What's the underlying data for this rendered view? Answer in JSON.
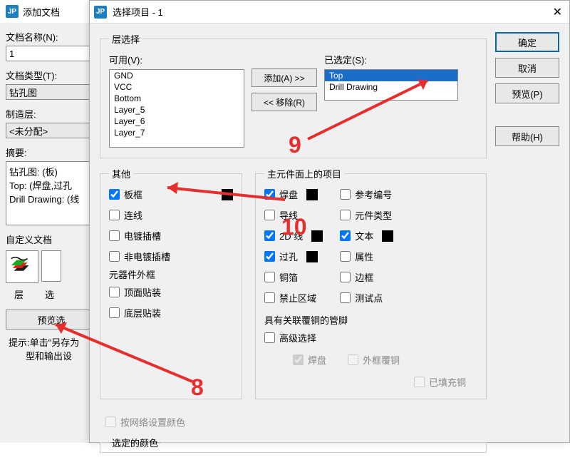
{
  "back": {
    "title": "添加文档",
    "docNameLabel": "文档名称(N):",
    "docNameValue": "1",
    "docTypeLabel": "文档类型(T):",
    "docTypeValue": "钻孔图",
    "fabLayerLabel": "制造层:",
    "fabLayerValue": "<未分配>",
    "summaryLabel": "摘要:",
    "summary1": "钻孔图: (板)",
    "summary2": "Top: (焊盘,过孔",
    "summary3": "Drill Drawing: (线",
    "customDocLabel": "自定义文档",
    "tabLayer": "层",
    "tabSel": "选",
    "previewBtn": "预览选",
    "tip1": "提示:单击\"另存为",
    "tip2": "型和输出设"
  },
  "front": {
    "title": "选择项目 - 1",
    "okBtn": "确定",
    "cancelBtn": "取消",
    "previewBtn": "预览(P)",
    "helpBtn": "帮助(H)",
    "layerSelLegend": "层选择",
    "availableLabel": "可用(V):",
    "selectedLabel": "已选定(S):",
    "availableItems": [
      "GND",
      "VCC",
      "Bottom",
      "Layer_5",
      "Layer_6",
      "Layer_7"
    ],
    "selectedItems": [
      "Top",
      "Drill Drawing"
    ],
    "addBtn": "添加(A) >>",
    "removeBtn": "<< 移除(R)",
    "otherLegend": "其他",
    "other": {
      "frame": "板框",
      "lines": "连线",
      "platedSlot": "电镀插槽",
      "nonPlatedSlot": "非电镀插槽"
    },
    "compOutlineLabel": "元器件外框",
    "compOutline": {
      "top": "顶面贴装",
      "bottom": "底层贴装"
    },
    "mainLegend": "主元件面上的项目",
    "main": {
      "pad": "焊盘",
      "wire": "导线",
      "line2d": "2D 线",
      "via": "过孔",
      "copper": "铜箔",
      "keepout": "禁止区域",
      "refdes": "参考编号",
      "compType": "元件类型",
      "text": "文本",
      "attr": "属性",
      "border": "边框",
      "testpoint": "测试点"
    },
    "assocLabel": "具有关联覆铜的管脚",
    "advanced": "高级选择",
    "padDis": "焊盘",
    "outerCopper": "外框覆铜",
    "filledCopper": "已填充铜",
    "byNetColor": "按网络设置颜色",
    "selColorLegend": "选定的颜色"
  },
  "annotations": {
    "n8": "8",
    "n9": "9",
    "n10": "10"
  }
}
